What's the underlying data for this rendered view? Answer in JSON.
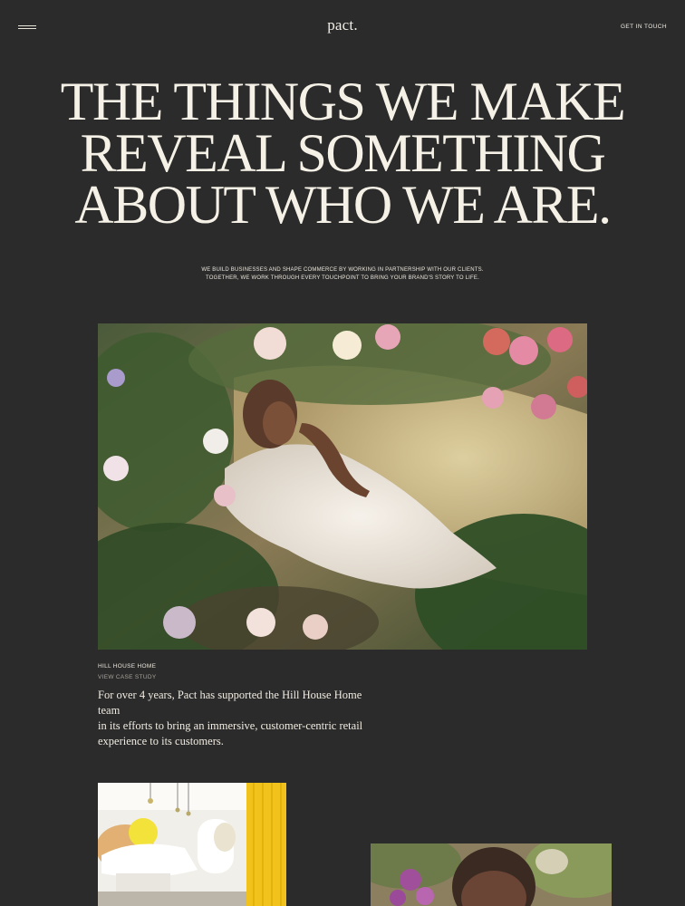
{
  "header": {
    "logo": "pact.",
    "cta_label": "GET IN TOUCH",
    "menu_icon": "hamburger-icon"
  },
  "hero": {
    "title_lines": [
      "THE THINGS WE MAKE",
      "REVEAL SOMETHING",
      "ABOUT WHO WE ARE."
    ]
  },
  "intro": {
    "lines": [
      "WE BUILD BUSINESSES AND SHAPE COMMERCE BY WORKING IN PARTNERSHIP WITH OUR CLIENTS.",
      "TOGETHER, WE WORK THROUGH EVERY TOUCHPOINT TO BRING YOUR BRAND'S STORY TO LIFE."
    ]
  },
  "projects": [
    {
      "client": "HILL HOUSE HOME",
      "link_label": "VIEW CASE STUDY",
      "description_lines": [
        "For over 4 years, Pact has supported the Hill House Home team",
        "in its efforts to bring an immersive, customer-centric retail",
        "experience to its customers."
      ]
    }
  ],
  "colors": {
    "background": "#2b2b2b",
    "text": "#f3efe6",
    "muted": "#a8a39a"
  }
}
